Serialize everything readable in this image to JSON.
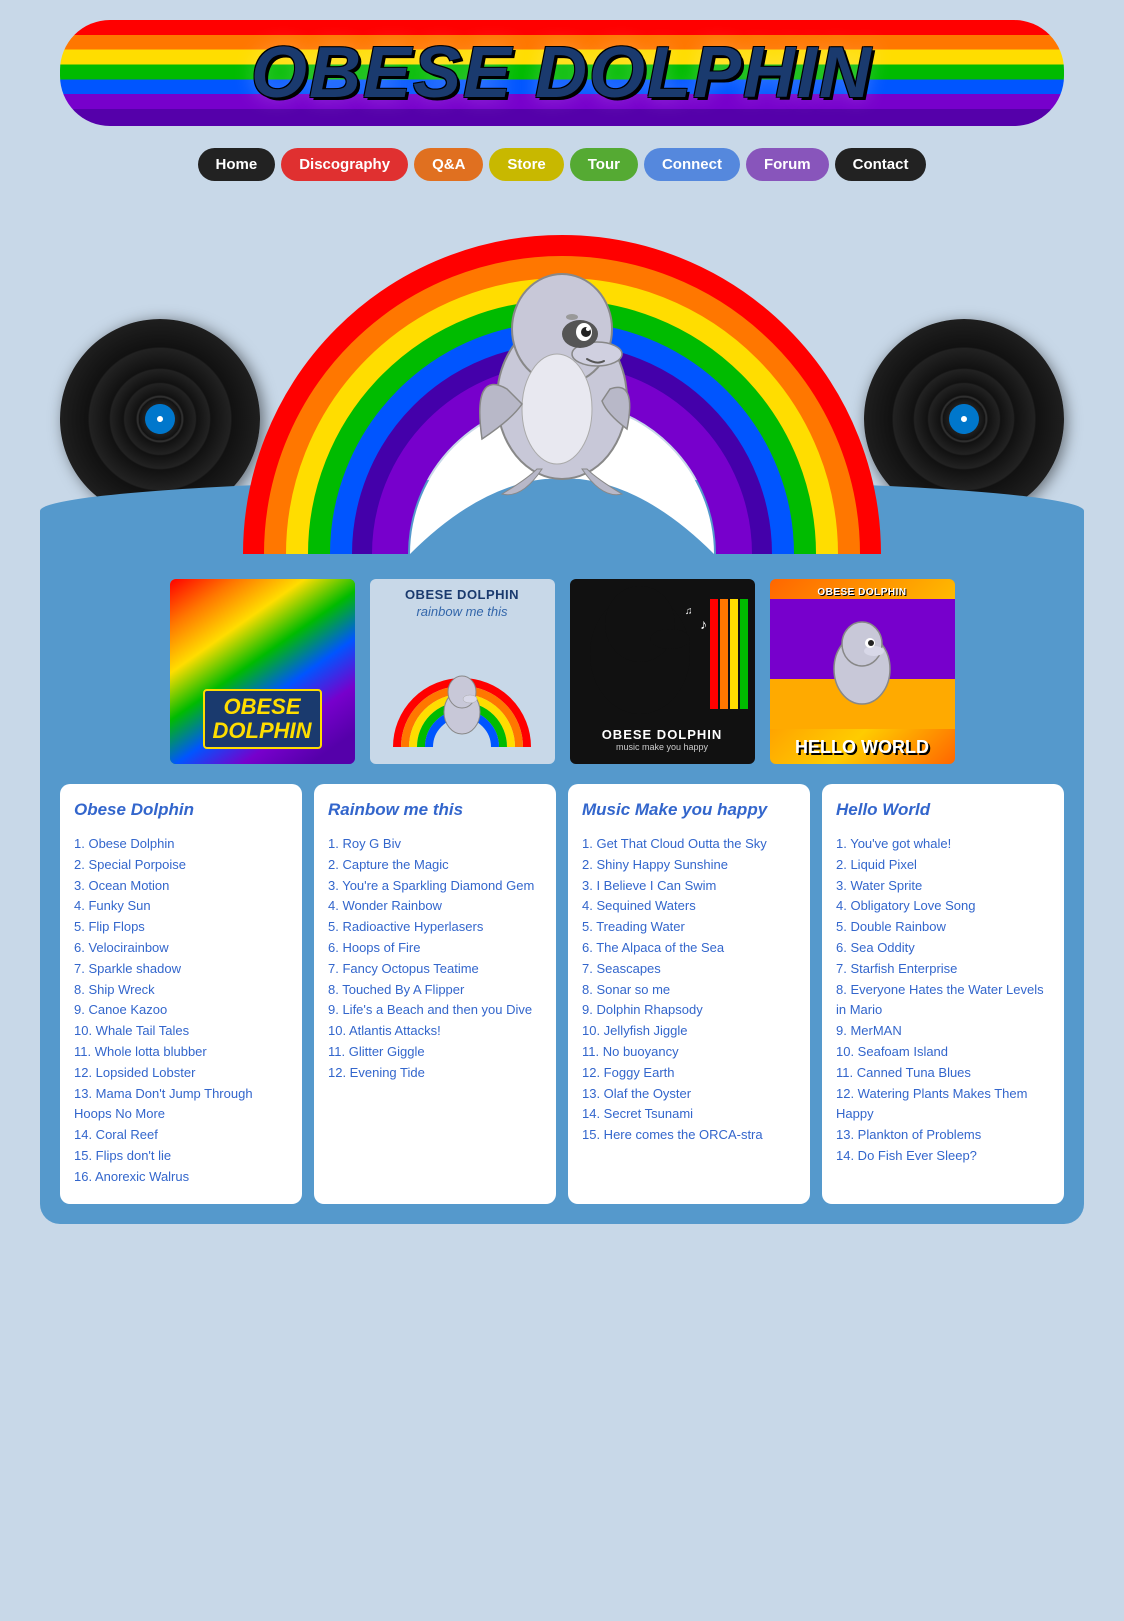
{
  "header": {
    "logo_text": "OBESE DOLPHIN"
  },
  "nav": {
    "items": [
      {
        "label": "Home",
        "class": "nav-home"
      },
      {
        "label": "Discography",
        "class": "nav-discography"
      },
      {
        "label": "Q&A",
        "class": "nav-qa"
      },
      {
        "label": "Store",
        "class": "nav-store"
      },
      {
        "label": "Tour",
        "class": "nav-tour"
      },
      {
        "label": "Connect",
        "class": "nav-connect"
      },
      {
        "label": "Forum",
        "class": "nav-forum"
      },
      {
        "label": "Contact",
        "class": "nav-contact"
      }
    ]
  },
  "albums": [
    {
      "id": "obese-dolphin",
      "title": "Obese Dolphin",
      "cover_label_line1": "OBESE",
      "cover_label_line2": "DOLPHIN"
    },
    {
      "id": "rainbow-me-this",
      "title": "Rainbow me this",
      "cover_line1": "OBESE DOLPHIN",
      "cover_line2": "rainbow me this"
    },
    {
      "id": "music-make-you-happy",
      "title": "Music Make you happy",
      "cover_line1": "OBESE",
      "cover_line2": "DOLPHIN",
      "cover_line3": "music make you happy"
    },
    {
      "id": "hello-world",
      "title": "Hello World",
      "cover_line1": "OBESE DOLPHIN",
      "cover_line2": "HELLO WORLD"
    }
  ],
  "tracklists": [
    {
      "album": "Obese Dolphin",
      "tracks": [
        "1. Obese Dolphin",
        "2. Special Porpoise",
        "3. Ocean Motion",
        "4. Funky Sun",
        "5. Flip Flops",
        "6. Velocirainbow",
        "7. Sparkle shadow",
        "8. Ship Wreck",
        "9. Canoe Kazoo",
        "10. Whale Tail Tales",
        "11. Whole lotta blubber",
        "12. Lopsided Lobster",
        "13. Mama Don't Jump Through Hoops No More",
        "14. Coral Reef",
        "15. Flips don't lie",
        "16. Anorexic Walrus"
      ]
    },
    {
      "album": "Rainbow me this",
      "tracks": [
        "1. Roy G Biv",
        "2. Capture the Magic",
        "3. You're a Sparkling Diamond Gem",
        "4. Wonder Rainbow",
        "5. Radioactive Hyperlasers",
        "6. Hoops of Fire",
        "7. Fancy Octopus Teatime",
        "8. Touched By A Flipper",
        "9. Life's a Beach and then you Dive",
        "10. Atlantis Attacks!",
        "11. Glitter Giggle",
        "12. Evening Tide"
      ]
    },
    {
      "album": "Music Make you happy",
      "tracks": [
        "1. Get That Cloud Outta the Sky",
        "2. Shiny Happy Sunshine",
        "3. I Believe I Can Swim",
        "4. Sequined Waters",
        "5. Treading Water",
        "6. The Alpaca of the Sea",
        "7. Seascapes",
        "8. Sonar so me",
        "9. Dolphin Rhapsody",
        "10. Jellyfish Jiggle",
        "11. No buoyancy",
        "12. Foggy Earth",
        "13. Olaf the Oyster",
        "14. Secret Tsunami",
        "15. Here comes the ORCA-stra"
      ]
    },
    {
      "album": "Hello World",
      "tracks": [
        "1. You've got whale!",
        "2. Liquid Pixel",
        "3. Water Sprite",
        "4. Obligatory Love Song",
        "5. Double Rainbow",
        "6. Sea Oddity",
        "7. Starfish Enterprise",
        "8. Everyone Hates the Water Levels in Mario",
        "9. MerMAN",
        "10. Seafoam Island",
        "11. Canned Tuna Blues",
        "12. Watering Plants Makes Them Happy",
        "13. Plankton of Problems",
        "14. Do Fish Ever Sleep?"
      ]
    }
  ]
}
